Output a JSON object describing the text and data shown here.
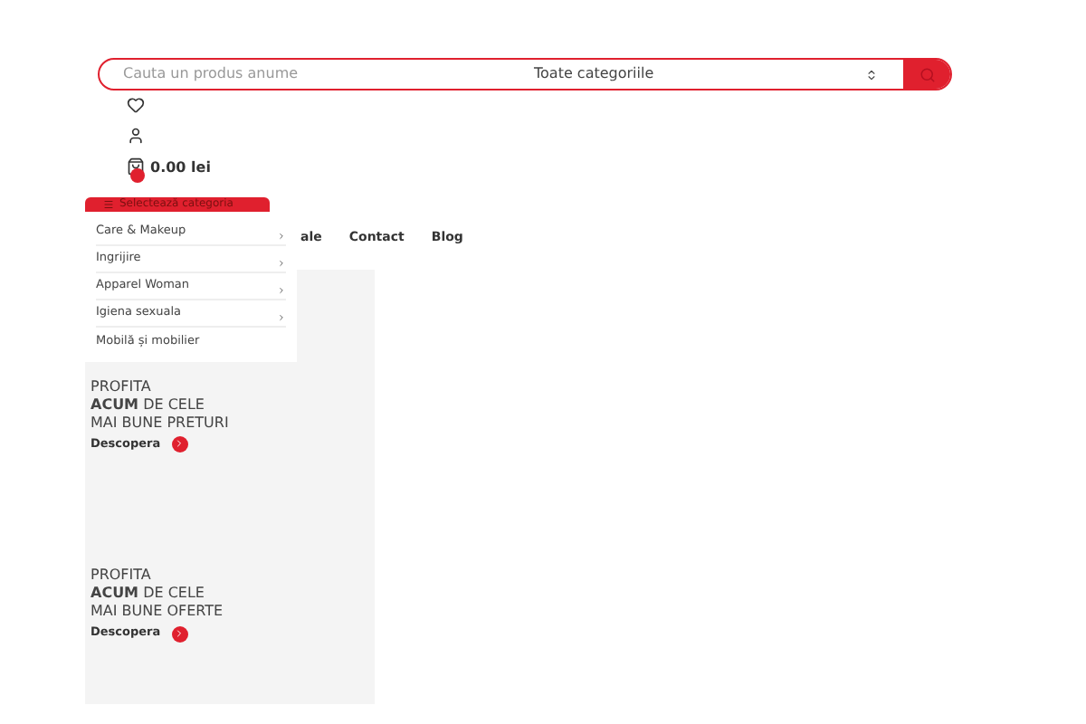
{
  "search": {
    "placeholder": "Cauta un produs anume",
    "category": "Toate categoriile"
  },
  "cart": {
    "total": "0.00 lei"
  },
  "category_button": {
    "label": "Selectează categoria"
  },
  "categories": [
    {
      "label": "Care & Makeup",
      "has_children": true
    },
    {
      "label": "Ingrijire",
      "has_children": true
    },
    {
      "label": "Apparel Woman",
      "has_children": true
    },
    {
      "label": "Igiena sexuala",
      "has_children": true
    },
    {
      "label": "Mobilă și mobilier",
      "has_children": false
    }
  ],
  "nav": [
    "ale",
    "Contact",
    "Blog"
  ],
  "banners": [
    {
      "lines": [
        "PROFITA",
        "**ACUM** DE CELE",
        "MAI BUNE PRETURI"
      ],
      "link": "Descopera"
    },
    {
      "lines": [
        "PROFITA",
        "**ACUM** DE CELE",
        "MAI BUNE OFERTE"
      ],
      "link": "Descopera"
    }
  ]
}
